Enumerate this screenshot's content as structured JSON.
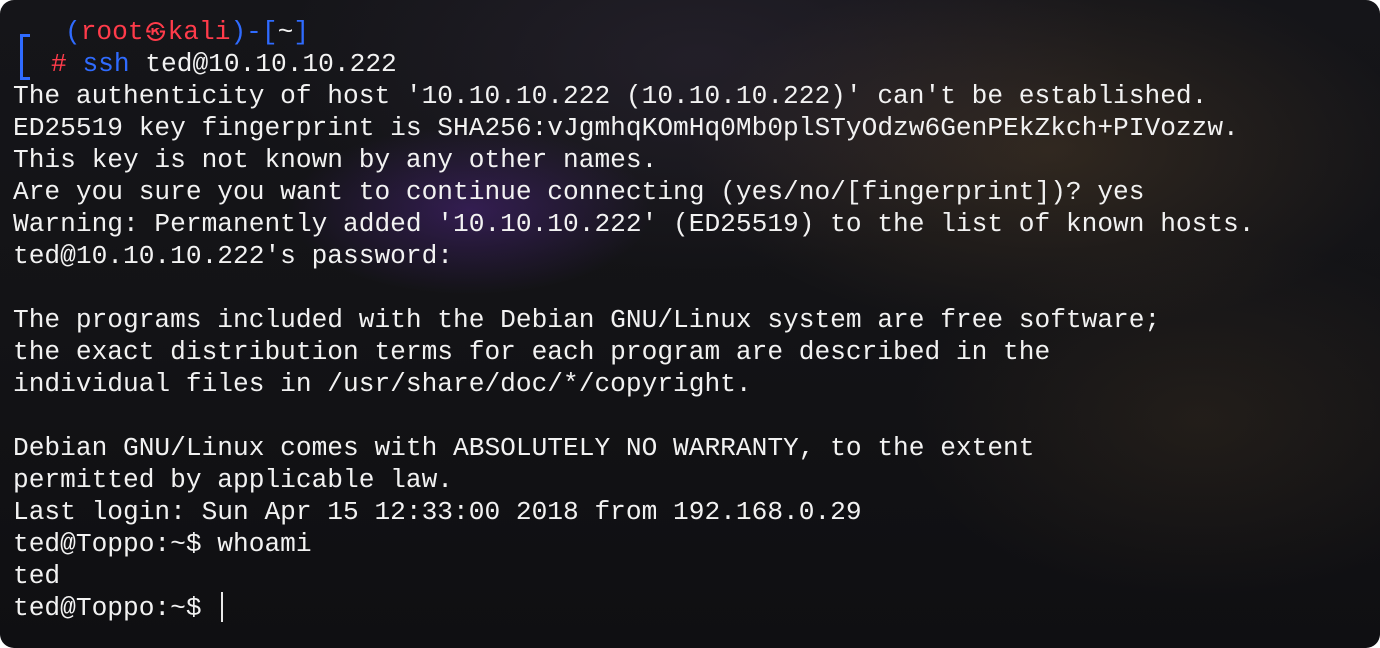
{
  "prompt": {
    "open_paren": "(",
    "user": "root",
    "at_symbol": "㉿",
    "host": "kali",
    "close_dash": ")-[",
    "dir": "~",
    "close_bracket": "]",
    "hash": "#",
    "command_name": "ssh",
    "command_args": " ted@10.10.10.222"
  },
  "output_lines_1": [
    "The authenticity of host '10.10.10.222 (10.10.10.222)' can't be established.",
    "ED25519 key fingerprint is SHA256:vJgmhqKOmHq0Mb0plSTyOdzw6GenPEkZkch+PIVozzw.",
    "This key is not known by any other names.",
    "Are you sure you want to continue connecting (yes/no/[fingerprint])? yes",
    "Warning: Permanently added '10.10.10.222' (ED25519) to the list of known hosts.",
    "ted@10.10.10.222's password:"
  ],
  "output_lines_2": [
    "The programs included with the Debian GNU/Linux system are free software;",
    "the exact distribution terms for each program are described in the",
    "individual files in /usr/share/doc/*/copyright."
  ],
  "output_lines_3": [
    "Debian GNU/Linux comes with ABSOLUTELY NO WARRANTY, to the extent",
    "permitted by applicable law.",
    "Last login: Sun Apr 15 12:33:00 2018 from 192.168.0.29",
    "ted@Toppo:~$ whoami",
    "ted"
  ],
  "final_prompt": "ted@Toppo:~$ ",
  "colors": {
    "prompt_blue": "#2f6bff",
    "prompt_red": "#ff3b4a",
    "text": "#f2f2f2",
    "background": "#141418"
  }
}
